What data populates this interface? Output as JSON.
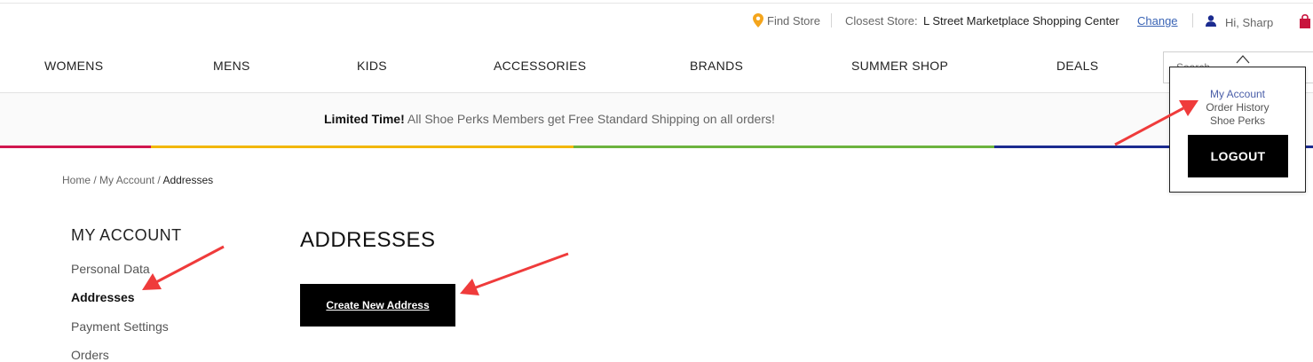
{
  "utility_bar": {
    "find_store": "Find Store",
    "closest_store_label": "Closest Store:",
    "closest_store_name": "L Street Marketplace Shopping Center",
    "change_link": "Change",
    "greeting": "Hi, Sharp"
  },
  "nav": {
    "items": [
      "WOMENS",
      "MENS",
      "KIDS",
      "ACCESSORIES",
      "BRANDS",
      "SUMMER SHOP",
      "DEALS"
    ],
    "search_placeholder": "Search"
  },
  "promo": {
    "bold": "Limited Time!",
    "text": "All Shoe Perks Members get Free Standard Shipping on all orders!"
  },
  "breadcrumb": {
    "home": "Home",
    "sep": "/",
    "my_account": "My Account",
    "current": "Addresses"
  },
  "sidebar": {
    "title": "MY ACCOUNT",
    "items": [
      "Personal Data",
      "Addresses",
      "Payment Settings",
      "Orders"
    ]
  },
  "main": {
    "title": "ADDRESSES",
    "create_button": "Create New Address"
  },
  "account_dropdown": {
    "items": [
      "My Account",
      "Order History",
      "Shoe Perks"
    ],
    "logout": "LOGOUT"
  },
  "colors": {
    "stripe": [
      "#d1174f",
      "#f2b705",
      "#6cb33e",
      "#1b2b8f"
    ],
    "annotation_arrow": "#ef3b3b",
    "link_blue": "#3a64b5",
    "pin_orange": "#f4a51c"
  },
  "icons": {
    "find_store": "map-pin-icon",
    "user": "user-icon",
    "bag": "shopping-bag-icon",
    "caret": "caret-up-icon"
  }
}
